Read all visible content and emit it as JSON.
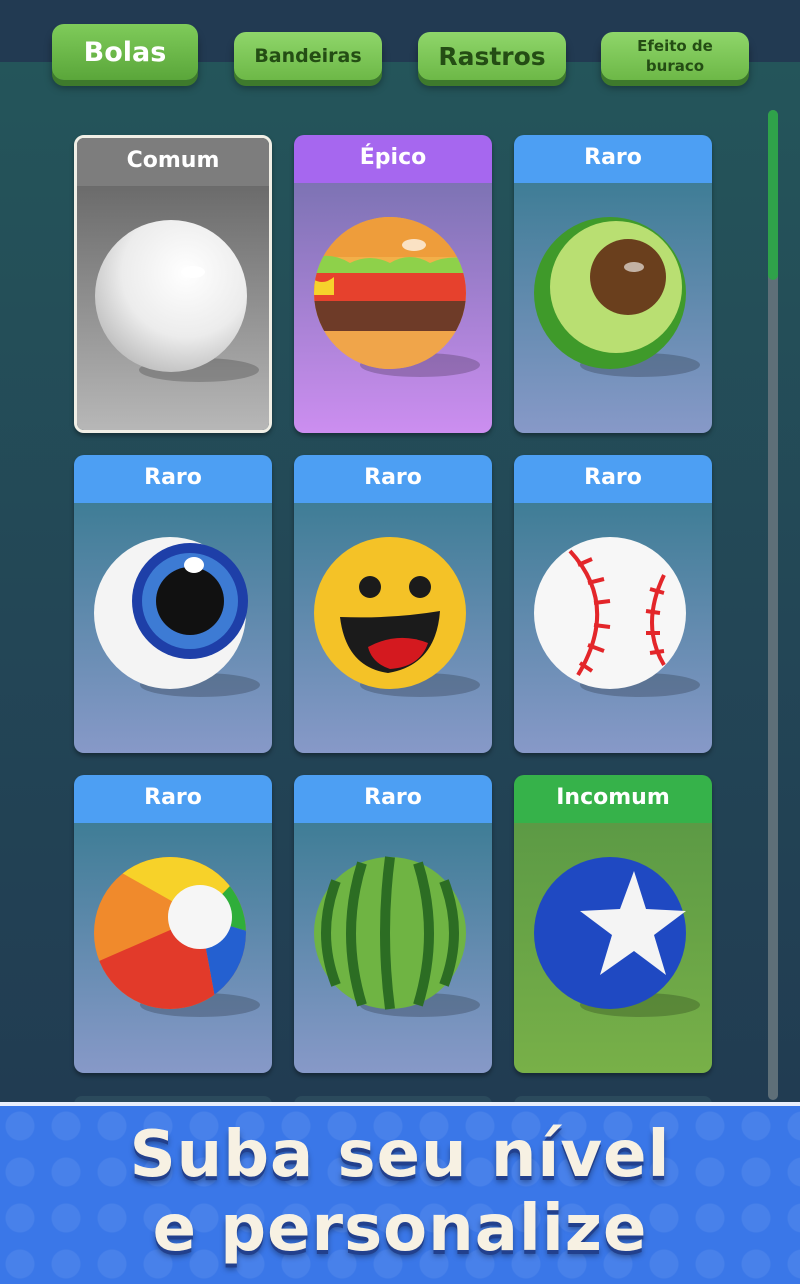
{
  "tabs": [
    {
      "label": "Bolas",
      "active": true
    },
    {
      "label": "Bandeiras",
      "active": false
    },
    {
      "label": "Rastros",
      "active": false
    },
    {
      "label": "Efeito de buraco",
      "active": false
    }
  ],
  "colors": {
    "rarity_comum": "#7d7d7d",
    "rarity_epico": "#a667ef",
    "rarity_raro": "#4d9ff3",
    "rarity_incomum": "#36b24a",
    "tab_green": "#6db847",
    "banner_blue": "#3a77e8"
  },
  "cards": [
    {
      "rarity": "Comum",
      "ball": "white-ball-icon",
      "selected": true
    },
    {
      "rarity": "Épico",
      "ball": "burger-ball-icon"
    },
    {
      "rarity": "Raro",
      "ball": "avocado-ball-icon"
    },
    {
      "rarity": "Raro",
      "ball": "eyeball-icon"
    },
    {
      "rarity": "Raro",
      "ball": "smiley-ball-icon"
    },
    {
      "rarity": "Raro",
      "ball": "baseball-icon"
    },
    {
      "rarity": "Raro",
      "ball": "beach-ball-icon"
    },
    {
      "rarity": "Raro",
      "ball": "watermelon-ball-icon"
    },
    {
      "rarity": "Incomum",
      "ball": "star-ball-icon"
    }
  ],
  "banner": {
    "line1": "Suba seu nível",
    "line2": "e personalize"
  }
}
